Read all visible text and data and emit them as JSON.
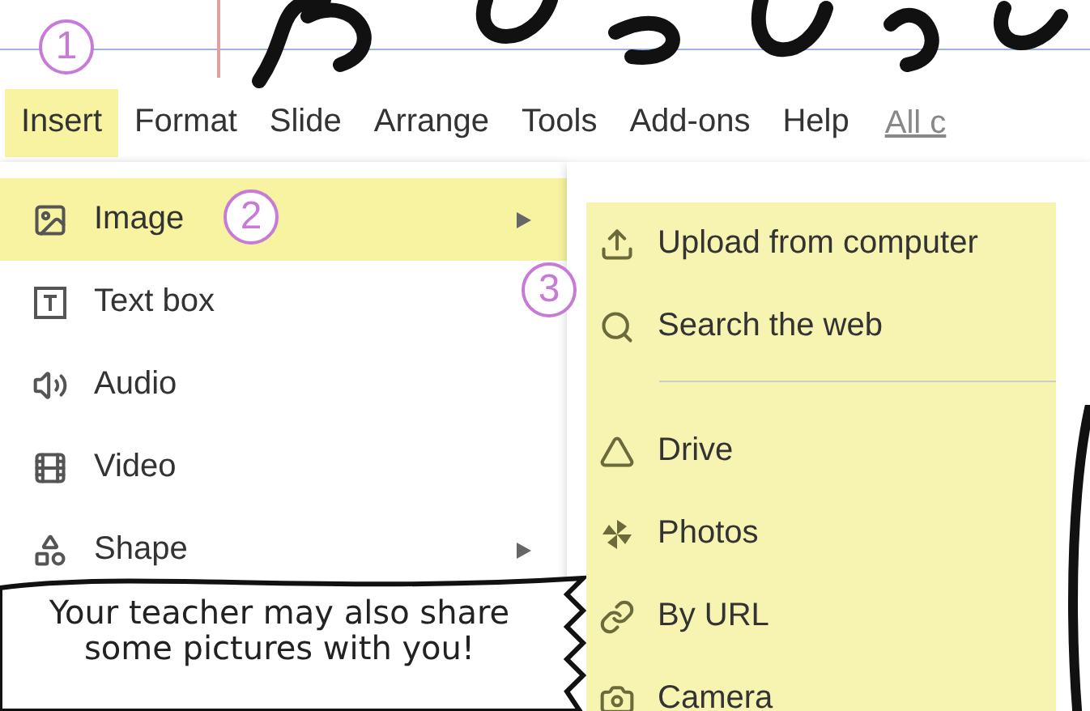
{
  "annotations": [
    {
      "number": "1"
    },
    {
      "number": "2"
    },
    {
      "number": "3"
    }
  ],
  "menu_bar": [
    {
      "label": "Insert",
      "selected": true
    },
    {
      "label": "Format",
      "selected": false
    },
    {
      "label": "Slide",
      "selected": false
    },
    {
      "label": "Arrange",
      "selected": false
    },
    {
      "label": "Tools",
      "selected": false
    },
    {
      "label": "Add-ons",
      "selected": false
    },
    {
      "label": "Help",
      "selected": false
    }
  ],
  "last_edit_link": "All c",
  "insert_menu": [
    {
      "label": "Image",
      "selected": true,
      "has_submenu": true
    },
    {
      "label": "Text box",
      "selected": false,
      "has_submenu": false
    },
    {
      "label": "Audio",
      "selected": false,
      "has_submenu": false
    },
    {
      "label": "Video",
      "selected": false,
      "has_submenu": false
    },
    {
      "label": "Shape",
      "selected": false,
      "has_submenu": true
    }
  ],
  "image_submenu": [
    [
      "Upload from computer",
      "Search the web"
    ],
    [
      "Drive",
      "Photos",
      "By URL",
      "Camera"
    ]
  ],
  "callout": "Your teacher may also share some pictures with you!"
}
